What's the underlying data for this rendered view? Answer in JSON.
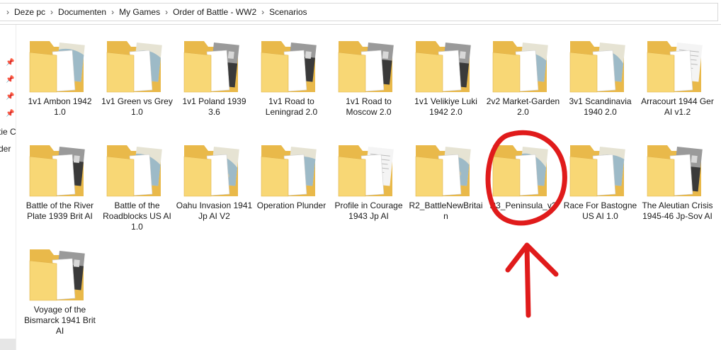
{
  "breadcrumb": [
    "Deze pc",
    "Documenten",
    "My Games",
    "Order of Battle - WW2",
    "Scenarios"
  ],
  "nav_pane": {
    "partial_labels": [
      "tie C",
      "der"
    ]
  },
  "folders": [
    {
      "label": "1v1 Ambon 1942 1.0",
      "thumb": "map"
    },
    {
      "label": "1v1 Green vs Grey 1.0",
      "thumb": "map"
    },
    {
      "label": "1v1 Poland 1939 3.6",
      "thumb": "photo"
    },
    {
      "label": "1v1 Road to Leningrad 2.0",
      "thumb": "photo"
    },
    {
      "label": "1v1 Road to Moscow 2.0",
      "thumb": "photo"
    },
    {
      "label": "1v1 Velikiye Luki 1942 2.0",
      "thumb": "photo"
    },
    {
      "label": "2v2 Market-Garden 2.0",
      "thumb": "map"
    },
    {
      "label": "3v1 Scandinavia 1940 2.0",
      "thumb": "map"
    },
    {
      "label": "Arracourt 1944 Ger AI v1.2",
      "thumb": "doc"
    },
    {
      "label": "Battle of the River Plate 1939 Brit AI",
      "thumb": "photo"
    },
    {
      "label": "Battle of the Roadblocks US AI 1.0",
      "thumb": "map"
    },
    {
      "label": "Oahu Invasion 1941 Jp AI V2",
      "thumb": "map"
    },
    {
      "label": "Operation Plunder",
      "thumb": "map"
    },
    {
      "label": "Profile in Courage 1943 Jp AI",
      "thumb": "doc"
    },
    {
      "label": "R2_BattleNewBritain",
      "thumb": "map"
    },
    {
      "label": "R3_Peninsula_v2",
      "thumb": "map"
    },
    {
      "label": "Race For Bastogne US AI 1.0",
      "thumb": "map"
    },
    {
      "label": "The Aleutian Crisis 1945-46 Jp-Sov AI",
      "thumb": "photo"
    },
    {
      "label": "Voyage of the Bismarck 1941 Brit AI",
      "thumb": "photo"
    }
  ],
  "annotation": {
    "color": "#e01b1b",
    "target": "R3_Peninsula_v2"
  },
  "colors": {
    "folder_back": "#e9b94a",
    "folder_front": "#f8d775",
    "map_water": "#8fb3c4",
    "map_land": "#e6e3d3",
    "photo_dark": "#3a3a3a",
    "doc_paper": "#f4f4f4"
  }
}
